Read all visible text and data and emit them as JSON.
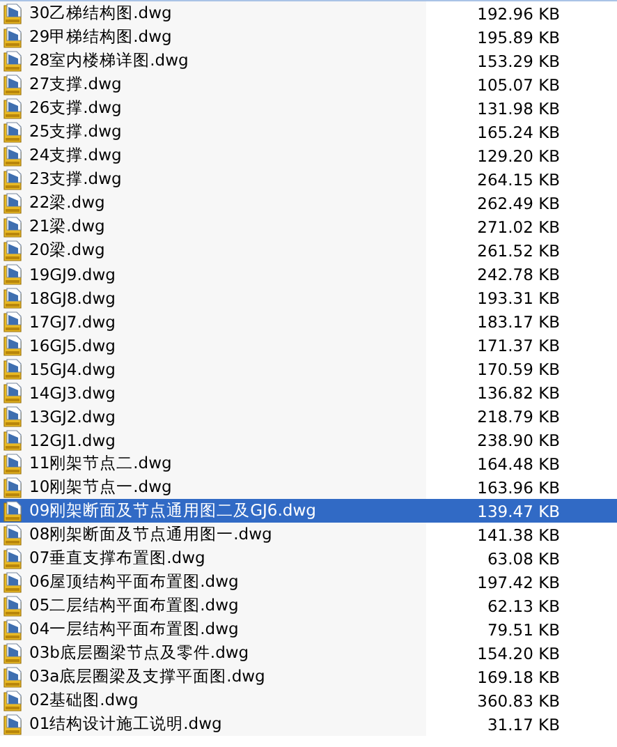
{
  "files": [
    {
      "name": "30乙梯结构图.dwg",
      "size": "192.96 KB",
      "selected": false
    },
    {
      "name": "29甲梯结构图.dwg",
      "size": "195.89 KB",
      "selected": false
    },
    {
      "name": "28室内楼梯详图.dwg",
      "size": "153.29 KB",
      "selected": false
    },
    {
      "name": "27支撑.dwg",
      "size": "105.07 KB",
      "selected": false
    },
    {
      "name": "26支撑.dwg",
      "size": "131.98 KB",
      "selected": false
    },
    {
      "name": "25支撑.dwg",
      "size": "165.24 KB",
      "selected": false
    },
    {
      "name": "24支撑.dwg",
      "size": "129.20 KB",
      "selected": false
    },
    {
      "name": "23支撑.dwg",
      "size": "264.15 KB",
      "selected": false
    },
    {
      "name": "22梁.dwg",
      "size": "262.49 KB",
      "selected": false
    },
    {
      "name": "21梁.dwg",
      "size": "271.02 KB",
      "selected": false
    },
    {
      "name": "20梁.dwg",
      "size": "261.52 KB",
      "selected": false
    },
    {
      "name": "19GJ9.dwg",
      "size": "242.78 KB",
      "selected": false
    },
    {
      "name": "18GJ8.dwg",
      "size": "193.31 KB",
      "selected": false
    },
    {
      "name": "17GJ7.dwg",
      "size": "183.17 KB",
      "selected": false
    },
    {
      "name": "16GJ5.dwg",
      "size": "171.37 KB",
      "selected": false
    },
    {
      "name": "15GJ4.dwg",
      "size": "170.59 KB",
      "selected": false
    },
    {
      "name": "14GJ3.dwg",
      "size": "136.82 KB",
      "selected": false
    },
    {
      "name": "13GJ2.dwg",
      "size": "218.79 KB",
      "selected": false
    },
    {
      "name": "12GJ1.dwg",
      "size": "238.90 KB",
      "selected": false
    },
    {
      "name": "11刚架节点二.dwg",
      "size": "164.48 KB",
      "selected": false
    },
    {
      "name": "10刚架节点一.dwg",
      "size": "163.96 KB",
      "selected": false
    },
    {
      "name": "09刚架断面及节点通用图二及GJ6.dwg",
      "size": "139.47 KB",
      "selected": true
    },
    {
      "name": "08刚架断面及节点通用图一.dwg",
      "size": "141.38 KB",
      "selected": false
    },
    {
      "name": "07垂直支撑布置图.dwg",
      "size": "63.08 KB",
      "selected": false
    },
    {
      "name": "06屋顶结构平面布置图.dwg",
      "size": "197.42 KB",
      "selected": false
    },
    {
      "name": "05二层结构平面布置图.dwg",
      "size": "62.13 KB",
      "selected": false
    },
    {
      "name": "04一层结构平面布置图.dwg",
      "size": "79.51 KB",
      "selected": false
    },
    {
      "name": "03b底层圈梁节点及零件.dwg",
      "size": "154.20 KB",
      "selected": false
    },
    {
      "name": "03a底层圈梁及支撑平面图.dwg",
      "size": "169.18 KB",
      "selected": false
    },
    {
      "name": "02基础图.dwg",
      "size": "360.83 KB",
      "selected": false
    },
    {
      "name": "01结构设计施工说明.dwg",
      "size": "31.17 KB",
      "selected": false
    }
  ]
}
